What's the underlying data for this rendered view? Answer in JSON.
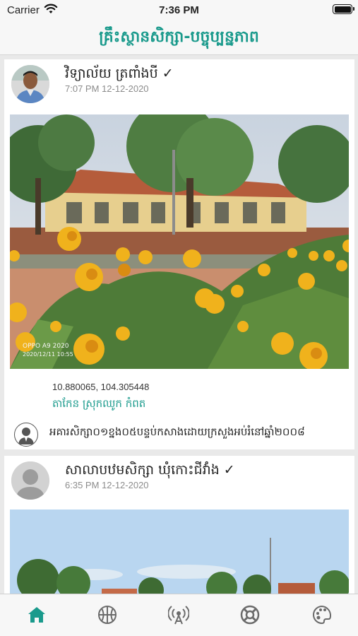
{
  "status_bar": {
    "carrier": "Carrier",
    "time": "7:36 PM"
  },
  "nav": {
    "title": "គ្រឹះស្ថានសិក្សា-បច្ចុប្បន្នភាព"
  },
  "posts": [
    {
      "author": "វិទ្យាល័យ ត្រពាំងបី ✓",
      "timestamp": "7:07 PM 12-12-2020",
      "photo_watermark": "OPPO A9 2020",
      "photo_datetime": "2020/12/11 10:55",
      "coordinates": "10.880065, 104.305448",
      "location": "តាកែន ស្រុកឈូក កំពត",
      "description": "អគារសិក្សា០១ខ្នង០៥បន្ទប់កសាងដោយក្រសួងអប់រំនៅឆ្នាំ២០០៨"
    },
    {
      "author": "សាលាបឋមសិក្សា ឃុំកោះជីវាំង ✓",
      "timestamp": "6:35 PM 12-12-2020"
    }
  ],
  "tabs": [
    {
      "icon": "home-icon",
      "active": true
    },
    {
      "icon": "basketball-icon",
      "active": false
    },
    {
      "icon": "broadcast-icon",
      "active": false
    },
    {
      "icon": "lifebuoy-icon",
      "active": false
    },
    {
      "icon": "palette-icon",
      "active": false
    }
  ],
  "colors": {
    "accent": "#1a9a8c",
    "tab_inactive": "#6b6b6b",
    "background": "#e9e9e9"
  }
}
